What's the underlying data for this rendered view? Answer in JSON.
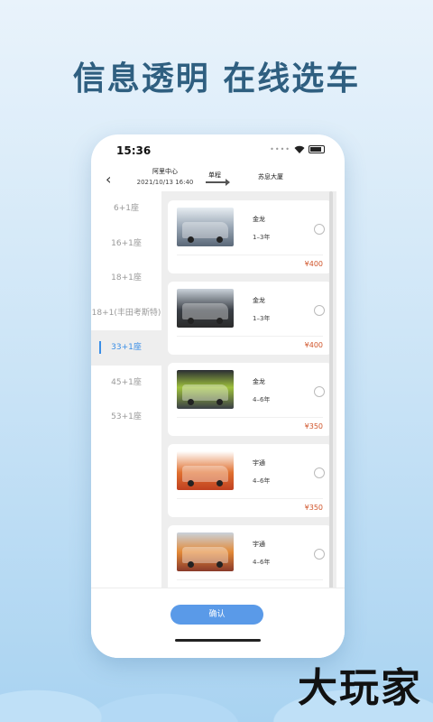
{
  "headline": "信息透明  在线选车",
  "status_bar": {
    "time": "15:36"
  },
  "nav": {
    "origin": "阿里中心",
    "date": "2021/10/13 16:40",
    "trip_type": "单程",
    "destination": "苏息大厦"
  },
  "sidebar": {
    "items": [
      {
        "label": "6+1座"
      },
      {
        "label": "16+1座"
      },
      {
        "label": "18+1座"
      },
      {
        "label": "18+1(丰田考斯特)"
      },
      {
        "label": "33+1座"
      },
      {
        "label": "45+1座"
      },
      {
        "label": "53+1座"
      }
    ],
    "active_index": 4
  },
  "vehicles": [
    {
      "brand": "金龙",
      "age": "1–3年",
      "price": "¥400"
    },
    {
      "brand": "金龙",
      "age": "1–3年",
      "price": "¥400"
    },
    {
      "brand": "金龙",
      "age": "4–6年",
      "price": "¥350"
    },
    {
      "brand": "宇通",
      "age": "4–6年",
      "price": "¥350"
    },
    {
      "brand": "宇通",
      "age": "4–6年",
      "price": ""
    }
  ],
  "confirm_label": "确认",
  "watermark": "大玩家",
  "colors": {
    "accent": "#3a8ee6",
    "price": "#d0542a",
    "button": "#5a9ae8",
    "headline": "#2f5f80"
  }
}
